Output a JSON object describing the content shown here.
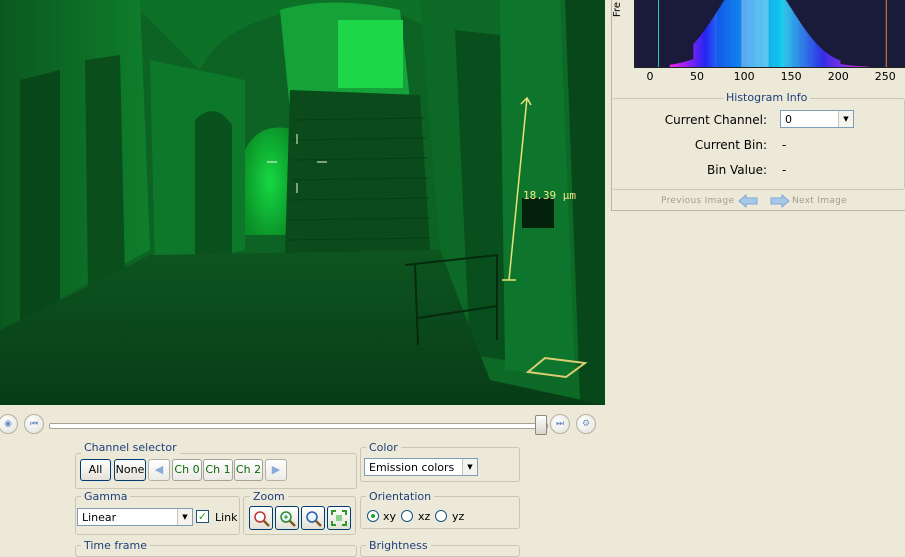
{
  "viewer": {
    "measurement_label": "18.39 µm",
    "image_tint": "#00c832"
  },
  "histogram": {
    "axis_title": "Fre",
    "ticks": [
      "0",
      "50",
      "100",
      "150",
      "200",
      "250"
    ],
    "info_title": "Histogram Info",
    "current_channel_label": "Current Channel:",
    "current_channel_value": "0",
    "current_bin_label": "Current Bin:",
    "current_bin_value": "-",
    "bin_value_label": "Bin Value:",
    "bin_value_value": "-",
    "previous_image_label": "Previous Image",
    "next_image_label": "Next Image"
  },
  "slider": {
    "position_fraction": 0.98
  },
  "channel_selector": {
    "title": "Channel selector",
    "all_label": "All",
    "none_label": "None",
    "channels": [
      "Ch 0",
      "Ch 1",
      "Ch 2"
    ]
  },
  "color": {
    "title": "Color",
    "selected": "Emission colors"
  },
  "gamma": {
    "title": "Gamma",
    "selected": "Linear",
    "link_label": "Link",
    "link_checked": true
  },
  "zoom": {
    "title": "Zoom",
    "icons": [
      "zoom-reset-icon",
      "zoom-in-icon",
      "zoom-out-icon",
      "zoom-fit-icon"
    ]
  },
  "orientation": {
    "title": "Orientation",
    "options": [
      "xy",
      "xz",
      "yz"
    ],
    "selected": "xy"
  },
  "time_frame": {
    "title": "Time frame"
  },
  "brightness": {
    "title": "Brightness"
  }
}
